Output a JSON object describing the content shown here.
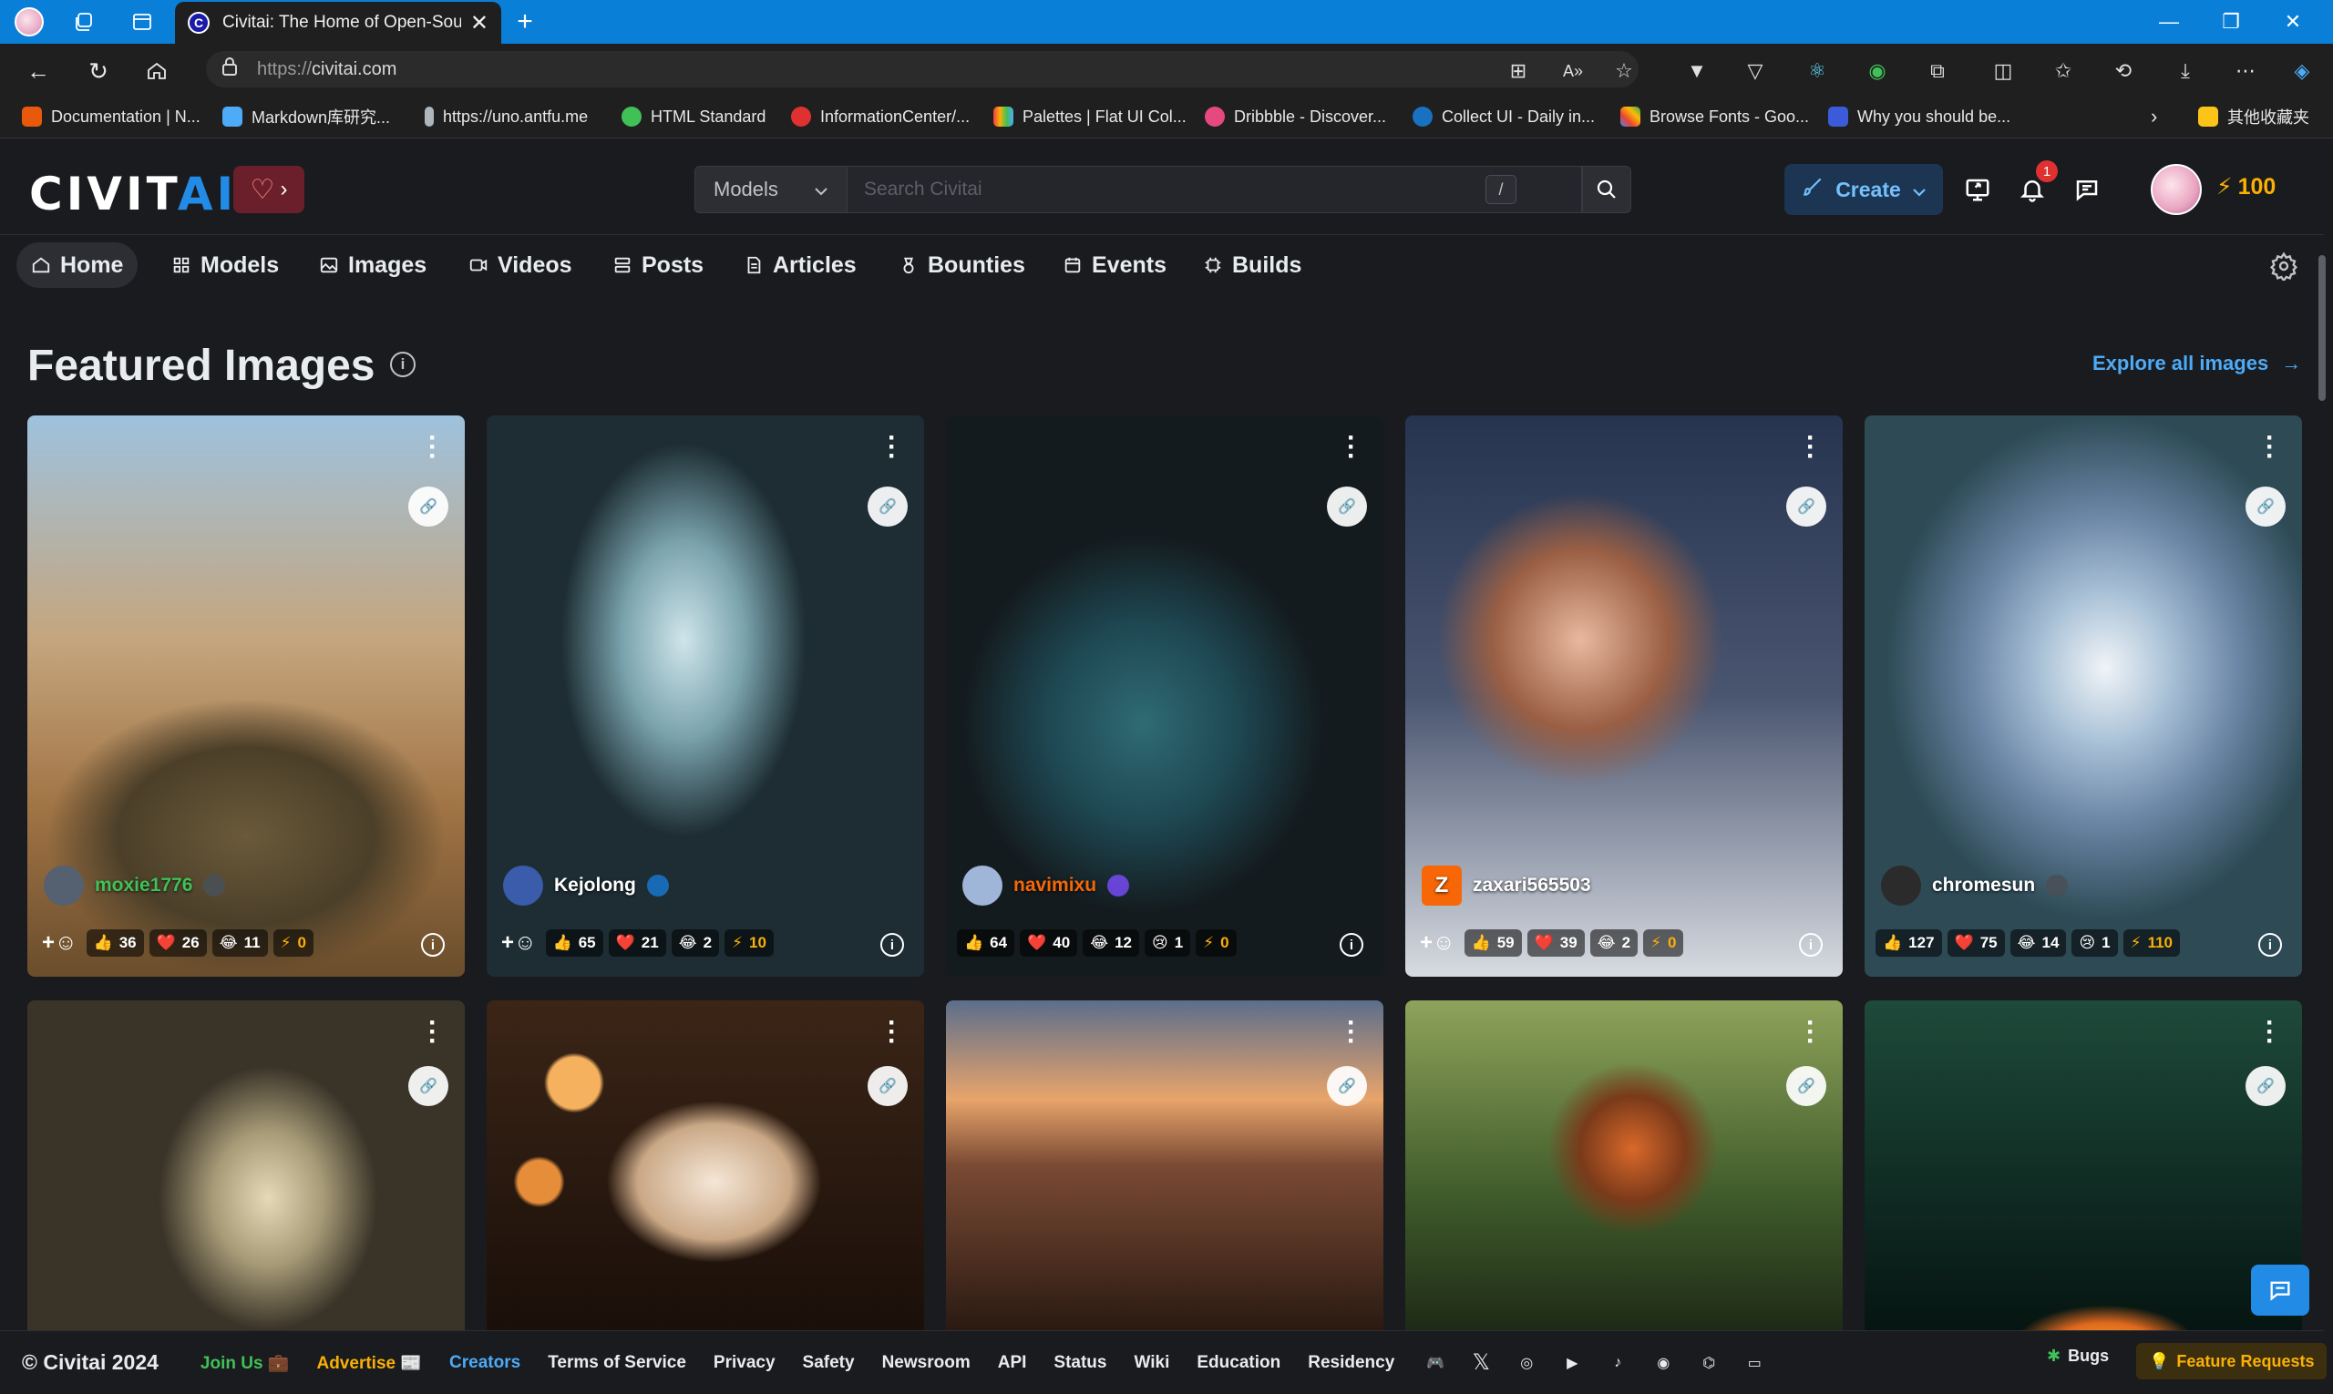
{
  "browser": {
    "tab_title": "Civitai: The Home of Open-Sourc",
    "tab_favicon": "C",
    "url_protocol": "https://",
    "url_host": "civitai.com",
    "bookmarks": [
      "Documentation | N...",
      "Markdown库研究...",
      "https://uno.antfu.me",
      "HTML Standard",
      "InformationCenter/...",
      "Palettes | Flat UI Col...",
      "Dribbble - Discover...",
      "Collect UI - Daily in...",
      "Browse Fonts - Goo...",
      "Why you should be..."
    ],
    "bookmarks_folder": "其他收藏夹"
  },
  "header": {
    "logo_main": "CIVIT",
    "logo_accent": "AI",
    "search_category": "Models",
    "search_placeholder": "Search Civitai",
    "search_shortcut": "/",
    "create_label": "Create",
    "notification_count": "1",
    "buzz_amount": "100"
  },
  "nav": {
    "items": [
      "Home",
      "Models",
      "Images",
      "Videos",
      "Posts",
      "Articles",
      "Bounties",
      "Events",
      "Builds"
    ]
  },
  "featured": {
    "title": "Featured Images",
    "explore_label": "Explore all images"
  },
  "cards": [
    {
      "author": "moxie1776",
      "like": "36",
      "heart": "26",
      "laugh": "11",
      "buzz": "0",
      "avatar_color": "#556070"
    },
    {
      "author": "Kejolong",
      "like": "65",
      "heart": "21",
      "laugh": "2",
      "buzz": "10",
      "avatar_color": "#3b5bab"
    },
    {
      "author": "navimixu",
      "like": "64",
      "heart": "40",
      "laugh": "12",
      "cry": "1",
      "buzz": "0",
      "avatar_color": "#9fb6d8"
    },
    {
      "author": "zaxari565503",
      "avatar_letter": "Z",
      "like": "59",
      "heart": "39",
      "laugh": "2",
      "buzz": "0",
      "avatar_color": "#f76707"
    },
    {
      "author": "chromesun",
      "like": "127",
      "heart": "75",
      "laugh": "14",
      "cry": "1",
      "buzz": "110",
      "avatar_color": "#2b2b2b"
    }
  ],
  "footer": {
    "copyright": "© Civitai 2024",
    "join_us": "Join Us",
    "advertise": "Advertise",
    "creators": "Creators",
    "links": [
      "Terms of Service",
      "Privacy",
      "Safety",
      "Newsroom",
      "API",
      "Status",
      "Wiki",
      "Education",
      "Residency"
    ],
    "bugs": "Bugs",
    "feature_requests": "Feature Requests"
  },
  "colors": {
    "accent_blue": "#228be6",
    "buzz_yellow": "#fab005",
    "page_bg": "#1a1b1e",
    "titlebar": "#0a7fd8"
  }
}
